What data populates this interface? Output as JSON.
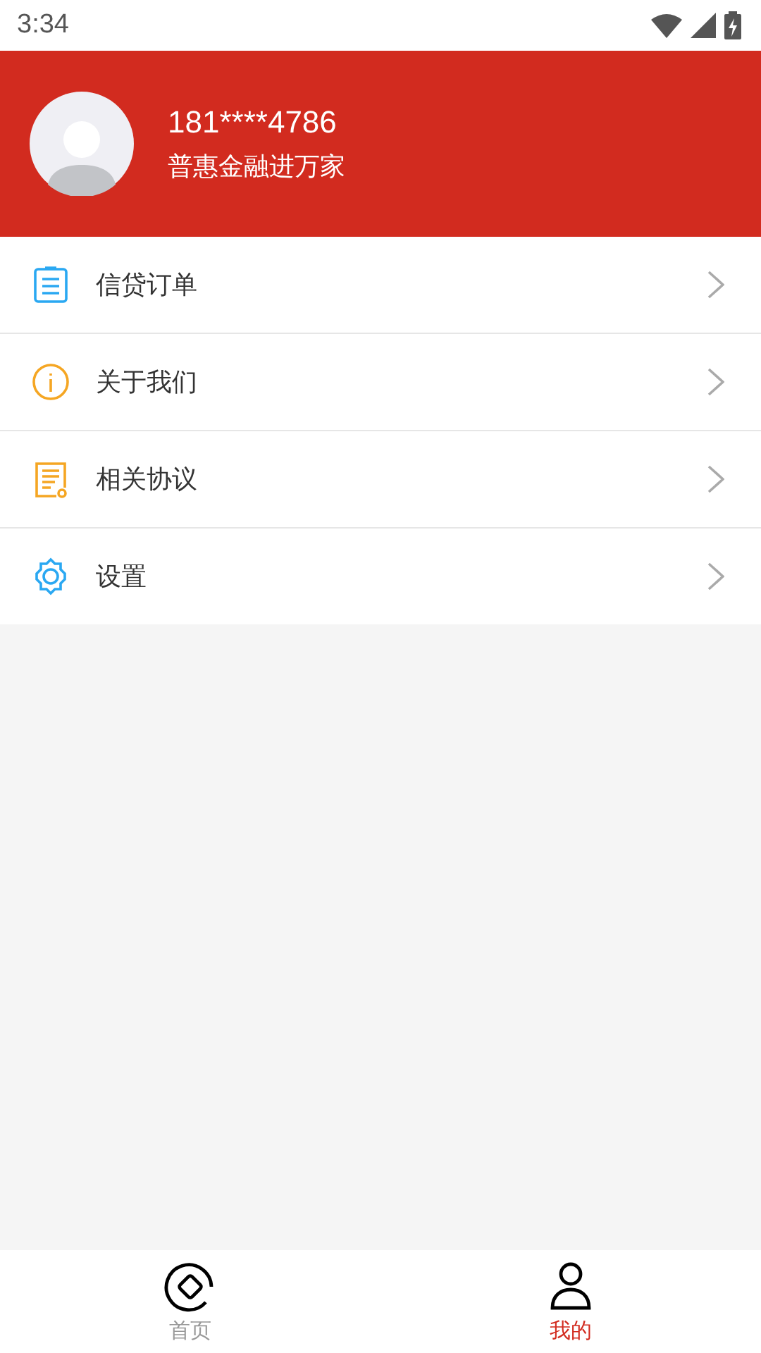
{
  "status_bar": {
    "time": "3:34"
  },
  "profile": {
    "phone": "181****4786",
    "slogan": "普惠金融进万家"
  },
  "menu": [
    {
      "label": "信贷订单",
      "kind": "clipboard",
      "color": "#2aa8f2"
    },
    {
      "label": "关于我们",
      "kind": "info",
      "color": "#f5a623"
    },
    {
      "label": "相关协议",
      "kind": "document",
      "color": "#f5a623"
    },
    {
      "label": "设置",
      "kind": "gear",
      "color": "#2aa8f2"
    }
  ],
  "tab_bar": [
    {
      "label": "首页",
      "kind": "home",
      "selected": false
    },
    {
      "label": "我的",
      "kind": "person",
      "selected": true
    }
  ]
}
